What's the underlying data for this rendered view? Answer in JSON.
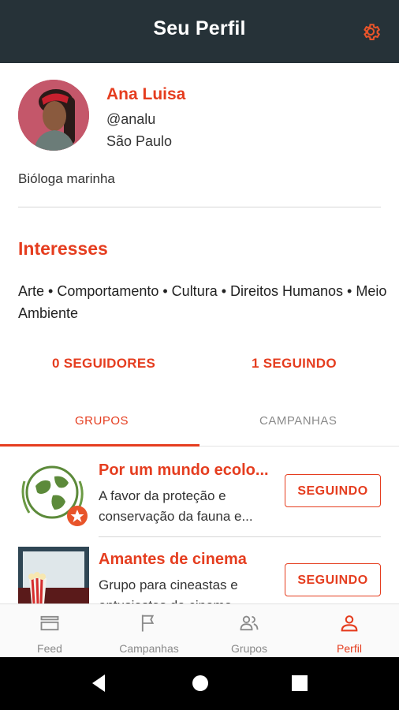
{
  "header": {
    "title": "Seu Perfil",
    "settings_icon": "gear-icon"
  },
  "profile": {
    "name": "Ana Luisa",
    "handle": "@analu",
    "city": "São Paulo",
    "bio": "Bióloga marinha"
  },
  "interests": {
    "title": "Interesses",
    "text": "Arte • Comportamento • Cultura • Direitos Humanos • Meio Ambiente"
  },
  "stats": {
    "followers": "0 SEGUIDORES",
    "following": "1 SEGUINDO"
  },
  "tabs": [
    {
      "label": "GRUPOS",
      "active": true
    },
    {
      "label": "CAMPANHAS",
      "active": false
    }
  ],
  "groups": [
    {
      "name": "Por um mundo ecolo...",
      "desc_line1": "A favor da proteção e",
      "desc_line2": "conservação da fauna e...",
      "button": "SEGUINDO"
    },
    {
      "name": "Amantes de cinema",
      "desc_line1": "Grupo para cineastas e",
      "desc_line2": "entusiastas do cinema",
      "button": "SEGUINDO"
    }
  ],
  "bottom_nav": [
    {
      "label": "Feed",
      "icon": "feed-icon"
    },
    {
      "label": "Campanhas",
      "icon": "flag-icon"
    },
    {
      "label": "Grupos",
      "icon": "people-icon"
    },
    {
      "label": "Perfil",
      "icon": "person-icon",
      "active": true
    }
  ],
  "colors": {
    "accent": "#e53d1f",
    "appbar": "#263238"
  }
}
